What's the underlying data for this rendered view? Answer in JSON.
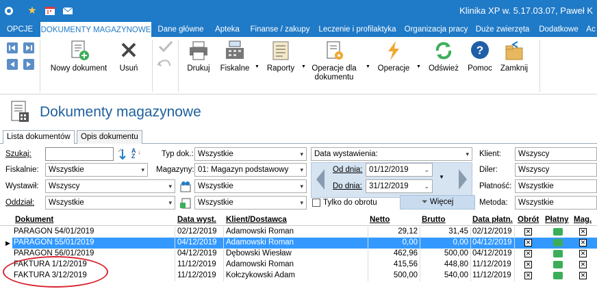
{
  "window": {
    "title": "Klinika XP w. 5.17.03.07, Paweł K"
  },
  "quick_access": [
    "app-menu-icon",
    "star-icon",
    "calendar-icon",
    "mail-icon"
  ],
  "ribbon_tabs": [
    "OPCJE",
    "DOKUMENTY MAGAZYNOWE",
    "Dane główne",
    "Apteka",
    "Finanse / zakupy",
    "Leczenie i profilaktyka",
    "Organizacja pracy",
    "Duże zwierzęta",
    "Dodatkowe",
    "Ac"
  ],
  "ribbon": {
    "new_doc": "Nowy dokument",
    "delete": "Usuń",
    "print": "Drukuj",
    "fiscal": "Fiskalne",
    "reports": "Raporty",
    "doc_ops": "Operacje dla dokumentu",
    "ops": "Operacje",
    "refresh": "Odśwież",
    "help": "Pomoc",
    "close": "Zamknij"
  },
  "page": {
    "title": "Dokumenty magazynowe"
  },
  "subtabs": [
    "Lista dokumentów",
    "Opis dokumentu"
  ],
  "filters": {
    "search_label": "Szukaj:",
    "search_value": "",
    "doc_type_label": "Typ dok.:",
    "doc_type_value": "Wszystkie",
    "date_field": "Data wystawienia:",
    "client_label": "Klient:",
    "client_value": "Wszyscy",
    "fiscal_label": "Fiskalnie:",
    "fiscal_value": "Wszystkie",
    "warehouse_label": "Magazyny:",
    "warehouse_value": "01: Magazyn podstawowy",
    "from_label": "Od dnia:",
    "from_value": "01/12/2019",
    "dealer_label": "Diler:",
    "dealer_value": "Wszyscy",
    "issuer_label": "Wystawił:",
    "issuer_value": "Wszyscy",
    "extra1_value": "Wszystkie",
    "to_label": "Do dnia:",
    "to_value": "31/12/2019",
    "payment_label": "Płatność:",
    "payment_value": "Wszystkie",
    "branch_label": "Oddział:",
    "branch_value": "Wszystkie",
    "extra2_value": "Wszystkie",
    "turnover_only": "Tylko do obrotu",
    "more_btn": "Więcej",
    "method_label": "Metoda:",
    "method_value": "Wszystkie"
  },
  "table": {
    "columns": [
      "Dokument",
      "Data wyst.",
      "Klient/Dostawca",
      "Netto",
      "Brutto",
      "Data płatn.",
      "Obrót",
      "Płatny",
      "Mag."
    ],
    "rows": [
      {
        "doc": "PARAGON 54/01/2019",
        "date": "02/12/2019",
        "client": "Adamowski Roman",
        "net": "29,12",
        "gross": "31,45",
        "paydate": "02/12/2019"
      },
      {
        "doc": "PARAGON 55/01/2019",
        "date": "04/12/2019",
        "client": "Adamowski Roman",
        "net": "0,00",
        "gross": "0,00",
        "paydate": "04/12/2019"
      },
      {
        "doc": "PARAGON 56/01/2019",
        "date": "04/12/2019",
        "client": "Dębowski Wiesław",
        "net": "462,96",
        "gross": "500,00",
        "paydate": "04/12/2019"
      },
      {
        "doc": "FAKTURA 1/12/2019",
        "date": "11/12/2019",
        "client": "Adamowski Roman",
        "net": "415,56",
        "gross": "448,80",
        "paydate": "11/12/2019"
      },
      {
        "doc": "FAKTURA 3/12/2019",
        "date": "11/12/2019",
        "client": "Kołczykowski Adam",
        "net": "500,00",
        "gross": "540,00",
        "paydate": "11/12/2019"
      }
    ],
    "selected_row": 1
  },
  "colors": {
    "accent": "#1f7ac7",
    "selection": "#3399ff",
    "annotation": "#d9232e"
  }
}
